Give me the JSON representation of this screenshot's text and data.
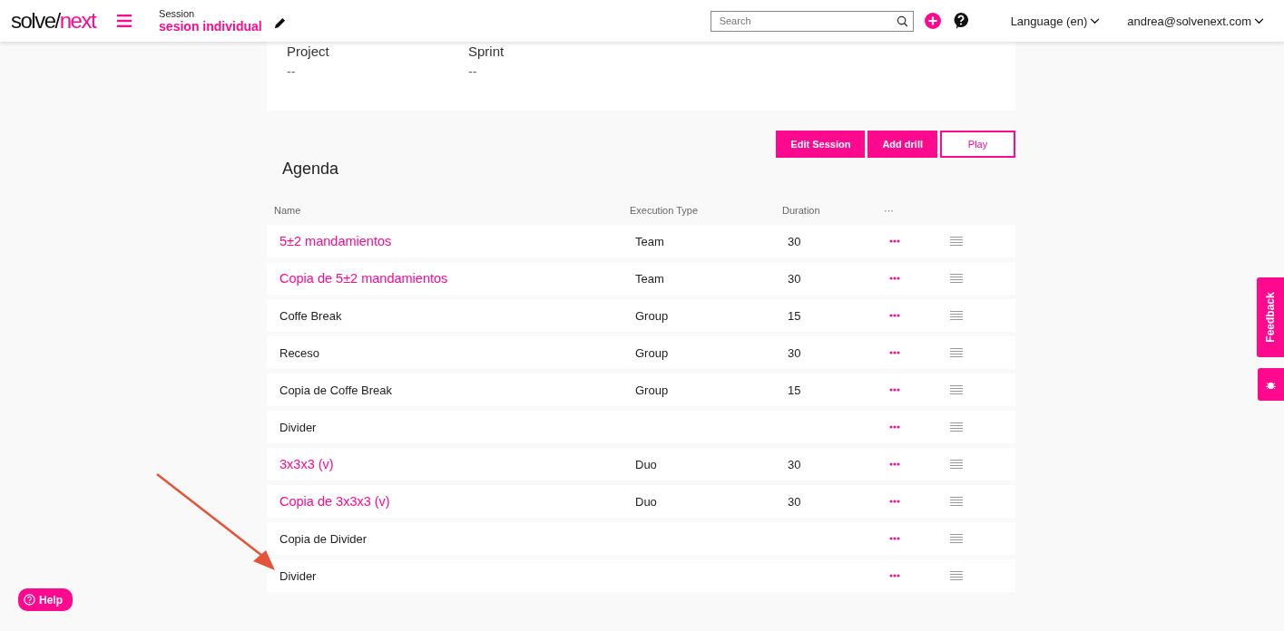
{
  "header": {
    "logo_left": "solve/",
    "logo_right": "next",
    "session_label": "Session",
    "session_name": "sesion individual",
    "search": {
      "placeholder": "Search"
    },
    "language": "Language (en)",
    "user": "andrea@solvenext.com"
  },
  "info": [
    {
      "label": "Project",
      "value": "--"
    },
    {
      "label": "Sprint",
      "value": "--"
    }
  ],
  "buttons": [
    {
      "label": "Edit Session",
      "kind": "filled"
    },
    {
      "label": "Add drill",
      "kind": "filled"
    },
    {
      "label": "Play",
      "kind": "outline"
    }
  ],
  "agenda": {
    "title": "Agenda",
    "columns": [
      "Name",
      "Execution Type",
      "Duration",
      "···"
    ],
    "rows": [
      {
        "name": "5±2 mandamientos",
        "kind": "drill",
        "type": "Team",
        "duration": "30"
      },
      {
        "name": "Copia de 5±2 mandamientos",
        "kind": "drill",
        "type": "Team",
        "duration": "30"
      },
      {
        "name": "Coffe Break",
        "kind": "plain",
        "type": "Group",
        "duration": "15"
      },
      {
        "name": "Receso",
        "kind": "plain",
        "type": "Group",
        "duration": "30"
      },
      {
        "name": "Copia de Coffe Break",
        "kind": "plain",
        "type": "Group",
        "duration": "15"
      },
      {
        "name": "Divider",
        "kind": "plain"
      },
      {
        "name": "3x3x3 (v)",
        "kind": "drill",
        "type": "Duo",
        "duration": "30"
      },
      {
        "name": "Copia de 3x3x3 (v)",
        "kind": "drill",
        "type": "Duo",
        "duration": "30"
      },
      {
        "name": "Copia de Divider",
        "kind": "plain"
      },
      {
        "name": "Divider",
        "kind": "plain"
      }
    ]
  },
  "feedback": "Feedback",
  "help": "Help"
}
